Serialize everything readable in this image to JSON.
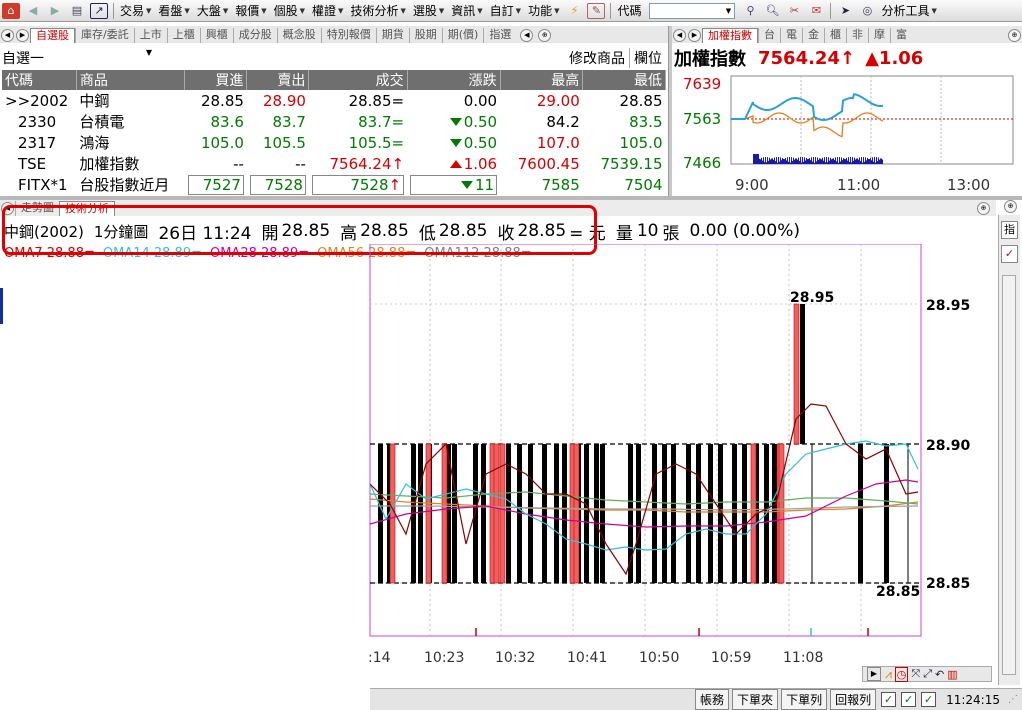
{
  "toolbar": {
    "menus": [
      "交易",
      "看盤",
      "大盤",
      "報價",
      "個股",
      "權證",
      "技術分析",
      "選股",
      "資訊",
      "自訂",
      "功能"
    ],
    "code_label": "代碼",
    "tools_label": "分析工具"
  },
  "watch_tabs": [
    "自選股",
    "庫存/委託",
    "上市",
    "上櫃",
    "興櫃",
    "成分股",
    "概念股",
    "特別報價",
    "期貨",
    "股期",
    "期(價)",
    "指選"
  ],
  "index_tabs": [
    "加權指數",
    "台",
    "電",
    "金",
    "櫃",
    "非",
    "摩",
    "富"
  ],
  "watchlist": {
    "group_name": "自選一",
    "edit_label": "修改商品",
    "column_label": "欄位",
    "headers": [
      "代碼",
      "商品",
      "買進",
      "賣出",
      "成交",
      "漲跌",
      "最高",
      "最低"
    ],
    "rows": [
      {
        "code": ">>2002",
        "name": "中鋼",
        "bid": "28.85",
        "ask": "28.90",
        "last": "28.85=",
        "chg": "0.00",
        "high": "29.00",
        "low": "28.85"
      },
      {
        "code": "2330",
        "name": "台積電",
        "bid": "83.6",
        "ask": "83.7",
        "last": "83.7=",
        "chg": "0.50",
        "high": "84.2",
        "low": "83.5"
      },
      {
        "code": "2317",
        "name": "鴻海",
        "bid": "105.0",
        "ask": "105.5",
        "last": "105.5=",
        "chg": "0.50",
        "high": "107.0",
        "low": "105.0"
      },
      {
        "code": "TSE",
        "name": "加權指數",
        "bid": "--",
        "ask": "--",
        "last": "7564.24",
        "chg": "1.06",
        "high": "7600.45",
        "low": "7539.15"
      },
      {
        "code": "FITX*1",
        "name": "台股指數近月",
        "bid": "7527",
        "ask": "7528",
        "last": "7528",
        "chg": "11",
        "high": "7585",
        "low": "7504"
      }
    ]
  },
  "index_panel": {
    "name": "加權指數",
    "value": "7564.24",
    "change": "1.06",
    "y_labels": [
      "7639",
      "7563",
      "7466"
    ],
    "x_labels": [
      "9:00",
      "11:00",
      "13:00"
    ]
  },
  "chart_tabs": [
    "走勢圖",
    "技術分析"
  ],
  "chart_info": {
    "symbol": "中鋼(2002)",
    "period": "1分鐘圖",
    "datetime": "26日 11:24",
    "open_label": "開",
    "open": "28.85",
    "high_label": "高",
    "high": "28.85",
    "low_label": "低",
    "low": "28.85",
    "close_label": "收",
    "close": "28.85",
    "close_suffix": "= 元",
    "volume_label": "量",
    "volume": "10",
    "volume_unit": "張",
    "change": "0.00 (0.00%)"
  },
  "ma_labels": [
    {
      "text": "OMA7 28.88=",
      "color": "#d40000"
    },
    {
      "text": "OMA14 28.89=",
      "color": "#30c0d8"
    },
    {
      "text": "OMA28 28.89=",
      "color": "#cc0099"
    },
    {
      "text": "OMA56 28.88=",
      "color": "#e08020"
    },
    {
      "text": "OMA112 28.88=",
      "color": "#808080"
    }
  ],
  "price_axis": [
    "28.95",
    "28.90",
    "28.85"
  ],
  "bar_labels": {
    "high": "28.95",
    "low": "28.85"
  },
  "time_axis": [
    ":14",
    "10:23",
    "10:32",
    "10:41",
    "10:50",
    "10:59",
    "11:08"
  ],
  "statusbar": {
    "buttons": [
      "帳務",
      "下單夾",
      "下單列",
      "回報列"
    ],
    "clock": "11:24:15"
  },
  "colors": {
    "up": "#d40000",
    "down": "#007a00",
    "ma7": "#8b0000",
    "ma14": "#30c0d8",
    "ma28": "#cc0099",
    "ma56": "#e08020",
    "ma112": "#808080",
    "chart_frame": "#cc44cc"
  }
}
